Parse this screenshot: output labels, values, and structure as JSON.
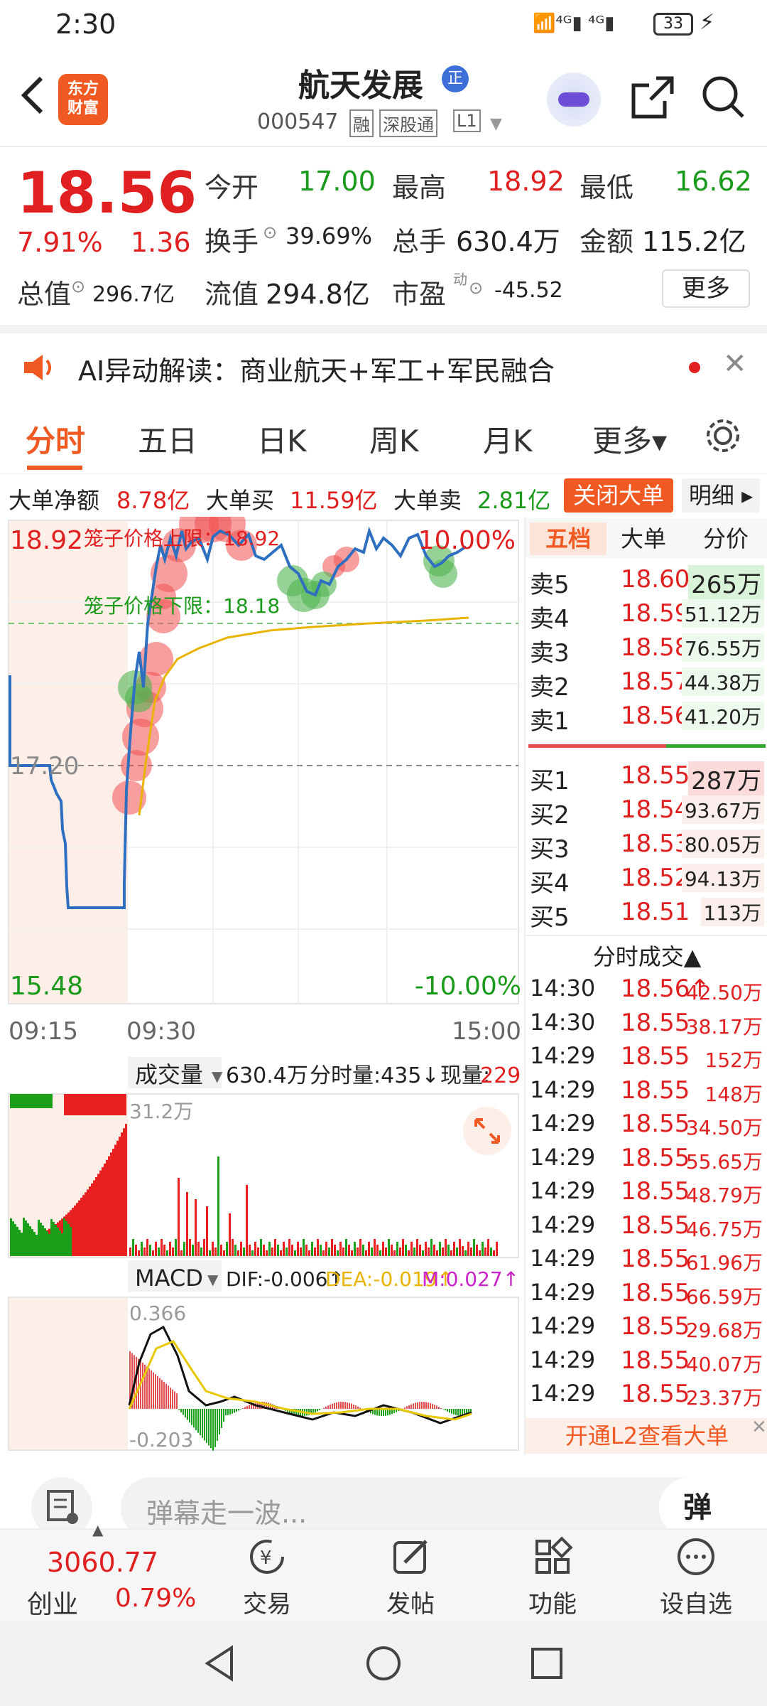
{
  "status": {
    "time": "2:30",
    "battery": "33"
  },
  "header": {
    "logo_line1": "东方",
    "logo_line2": "财富",
    "title": "航天发展",
    "title_badge": "正",
    "code": "000547",
    "tag1": "融",
    "tag2": "深股通",
    "tag3": "L1"
  },
  "quote": {
    "price": "18.56",
    "pct": "7.91%",
    "chg": "1.36",
    "open_label": "今开",
    "open": "17.00",
    "high_label": "最高",
    "high": "18.92",
    "low_label": "最低",
    "low": "16.62",
    "turnover_label": "换手",
    "turnover": "39.69%",
    "volume_label": "总手",
    "volume": "630.4万",
    "amount_label": "金额",
    "amount": "115.2亿",
    "mktcap_label": "总值",
    "mktcap": "296.7亿",
    "float_label": "流值",
    "float": "294.8亿",
    "pe_label": "市盈",
    "pe_sup": "动",
    "pe": "-45.52",
    "more": "更多"
  },
  "banner": {
    "text": "AI异动解读：商业航天+军工+军民融合"
  },
  "tabs": [
    "分时",
    "五日",
    "日K",
    "周K",
    "月K",
    "更多▾"
  ],
  "flow": {
    "net_label": "大单净额",
    "net": "8.78亿",
    "buy_label": "大单买",
    "buy": "11.59亿",
    "sell_label": "大单卖",
    "sell": "2.81亿",
    "close_btn": "关闭大单",
    "detail_btn": "明细"
  },
  "chart": {
    "price_high": "18.92",
    "price_mid": "17.20",
    "price_low": "15.48",
    "pct_high": "10.00%",
    "pct_low": "-10.00%",
    "cage_upper": "笼子价格上限：18.92",
    "cage_lower": "笼子价格下限：18.18",
    "time_start": "09:15",
    "time_open": "09:30",
    "time_end": "15:00"
  },
  "volume": {
    "selector": "成交量",
    "total": "630.4万",
    "minute_label": "分时量:435↓",
    "now_label": "现量:",
    "now": "229",
    "max_label": "31.2万"
  },
  "macd": {
    "selector": "MACD",
    "dif": "DIF:-0.006↑",
    "dea": "DEA:-0.019↑",
    "m": "M:0.027↑",
    "top": "0.366",
    "bottom": "-0.203"
  },
  "orderbook": {
    "tabs": [
      "五档",
      "大单",
      "分价"
    ],
    "asks": [
      {
        "label": "卖5",
        "price": "18.60",
        "vol": "265万"
      },
      {
        "label": "卖4",
        "price": "18.59",
        "vol": "51.12万"
      },
      {
        "label": "卖3",
        "price": "18.58",
        "vol": "76.55万"
      },
      {
        "label": "卖2",
        "price": "18.57",
        "vol": "44.38万"
      },
      {
        "label": "卖1",
        "price": "18.56",
        "vol": "41.20万"
      }
    ],
    "bids": [
      {
        "label": "买1",
        "price": "18.55",
        "vol": "287万"
      },
      {
        "label": "买2",
        "price": "18.54",
        "vol": "93.67万"
      },
      {
        "label": "买3",
        "price": "18.53",
        "vol": "80.05万"
      },
      {
        "label": "买4",
        "price": "18.52",
        "vol": "94.13万"
      },
      {
        "label": "买5",
        "price": "18.51",
        "vol": "113万"
      }
    ]
  },
  "trades": {
    "title": "分时成交▲",
    "rows": [
      {
        "t": "14:30",
        "p": "18.56↑",
        "v": "42.50万"
      },
      {
        "t": "14:30",
        "p": "18.55",
        "v": "38.17万"
      },
      {
        "t": "14:29",
        "p": "18.55",
        "v": "152万"
      },
      {
        "t": "14:29",
        "p": "18.55",
        "v": "148万"
      },
      {
        "t": "14:29",
        "p": "18.55",
        "v": "34.50万"
      },
      {
        "t": "14:29",
        "p": "18.55",
        "v": "55.65万"
      },
      {
        "t": "14:29",
        "p": "18.55",
        "v": "48.79万"
      },
      {
        "t": "14:29",
        "p": "18.55",
        "v": "46.75万"
      },
      {
        "t": "14:29",
        "p": "18.55",
        "v": "61.96万"
      },
      {
        "t": "14:29",
        "p": "18.55",
        "v": "66.59万"
      },
      {
        "t": "14:29",
        "p": "18.55",
        "v": "29.68万"
      },
      {
        "t": "14:29",
        "p": "18.55",
        "v": "40.07万"
      },
      {
        "t": "14:29",
        "p": "18.55",
        "v": "23.37万"
      }
    ],
    "l2": "开通L2查看大单"
  },
  "danmu": {
    "placeholder": "弹幕走一波...",
    "btn": "弹"
  },
  "bottom": {
    "index_value": "3060.77",
    "index_name": "创业",
    "index_pct": "0.79%",
    "nav": [
      "交易",
      "发帖",
      "功能",
      "设自选"
    ]
  },
  "colors": {
    "up": "#e02020",
    "down": "#1a9a1a",
    "accent": "#f05a22",
    "line": "#2f6fbf",
    "avg": "#e8b400"
  }
}
